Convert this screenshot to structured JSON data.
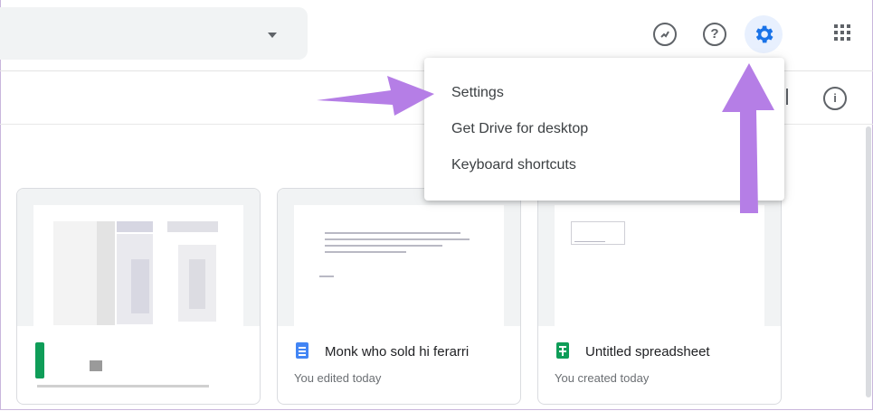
{
  "toolbar": {
    "icons": [
      "offline-sync-icon",
      "help-icon",
      "settings-gear-icon",
      "apps-grid-icon"
    ],
    "info_icon": "info-icon"
  },
  "settings_menu": {
    "items": [
      {
        "label": "Settings"
      },
      {
        "label": "Get Drive for desktop"
      },
      {
        "label": "Keyboard shortcuts"
      }
    ]
  },
  "files": [
    {
      "title": "",
      "subtitle": "",
      "type": "spreadsheet"
    },
    {
      "title": "Monk who sold hi ferarri",
      "subtitle": "You edited today",
      "type": "document"
    },
    {
      "title": "Untitled spreadsheet",
      "subtitle": "You created today",
      "type": "spreadsheet"
    }
  ],
  "colors": {
    "accent": "#1a73e8",
    "annotation_arrow": "#b57ee6",
    "docs": "#4285f4",
    "sheets": "#0f9d58"
  }
}
